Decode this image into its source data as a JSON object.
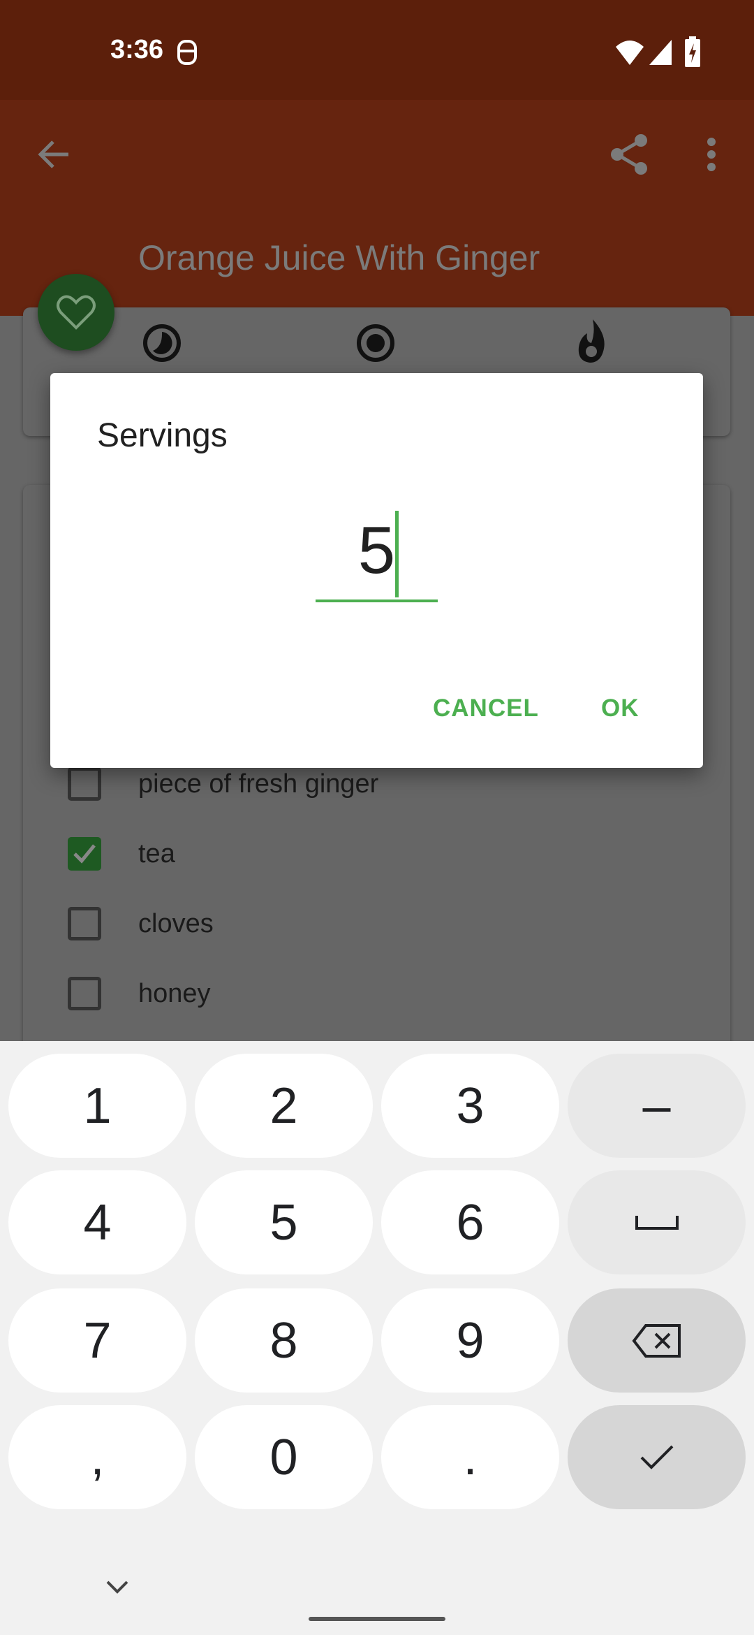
{
  "status_bar": {
    "time": "3:36",
    "icons": [
      "notification-icon",
      "wifi-icon",
      "signal-icon",
      "battery-charging-icon"
    ]
  },
  "app_bar": {
    "title": "Orange Juice With Ginger",
    "back_icon": "arrow-back-icon",
    "share_icon": "share-icon",
    "more_icon": "more-vert-icon"
  },
  "fab": {
    "icon": "heart-outline-icon",
    "color": "#1e4d20"
  },
  "info_card": {
    "icons": [
      "clock-icon",
      "target-icon",
      "flame-icon"
    ]
  },
  "ingredients": [
    {
      "label": "piece of fresh ginger",
      "checked": false
    },
    {
      "label": "tea",
      "checked": true
    },
    {
      "label": "cloves",
      "checked": false
    },
    {
      "label": "honey",
      "checked": false
    }
  ],
  "dialog": {
    "title": "Servings",
    "value": "5",
    "cancel_label": "CANCEL",
    "ok_label": "OK",
    "accent": "#4caf50"
  },
  "keyboard": {
    "keys": [
      "1",
      "2",
      "3",
      "–",
      "4",
      "5",
      "6",
      "space",
      "7",
      "8",
      "9",
      "backspace",
      ",",
      "0",
      ".",
      "done"
    ]
  }
}
